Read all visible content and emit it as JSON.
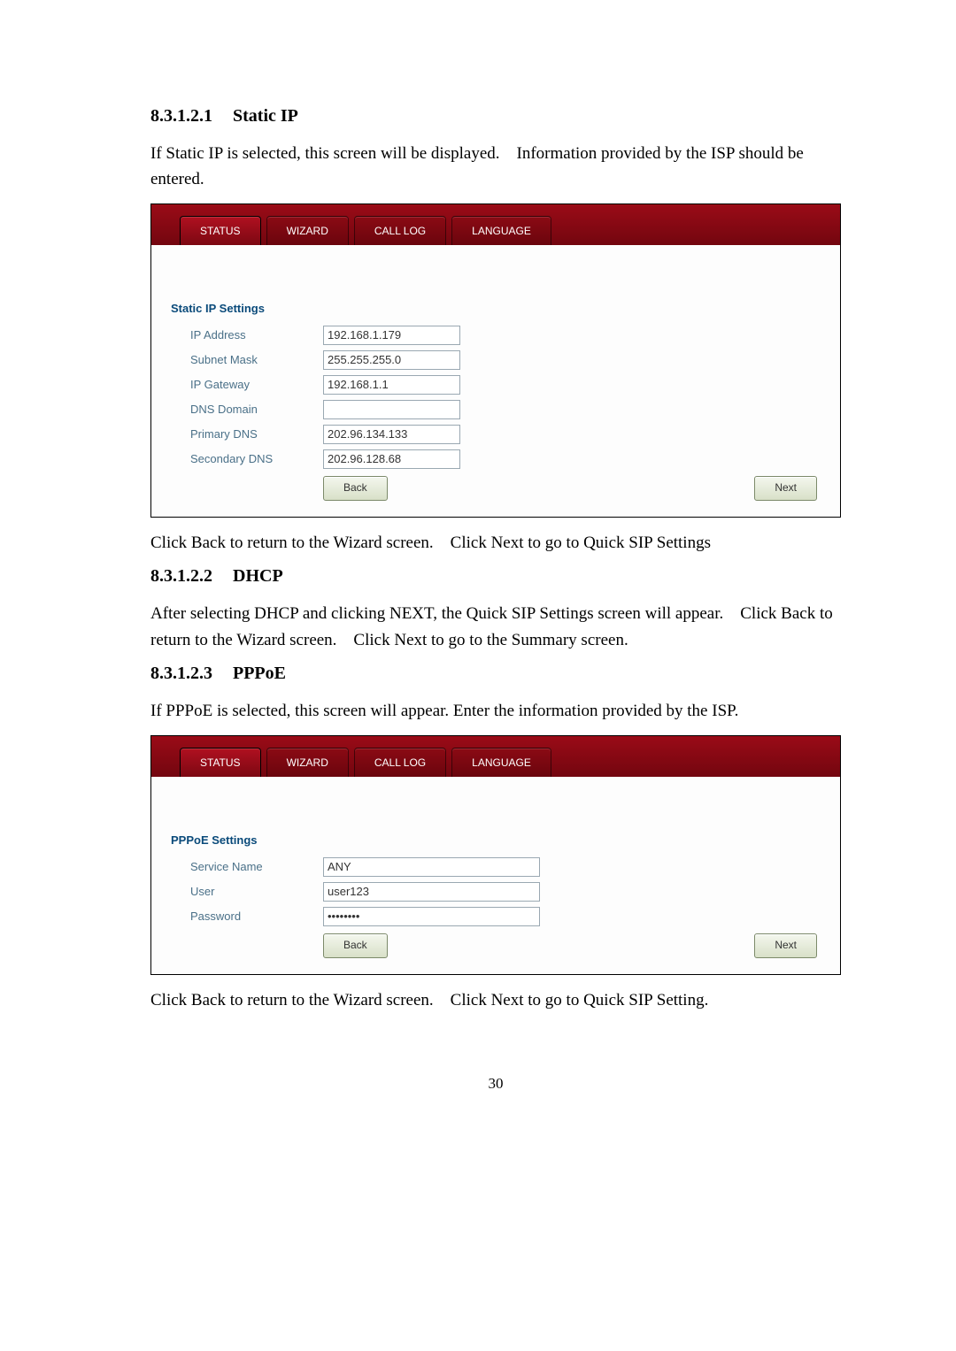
{
  "page_number": "30",
  "sections": {
    "s1": {
      "num": "8.3.1.2.1",
      "title": "Static IP",
      "para": "If Static IP is selected, this screen will be displayed. Information provided by the ISP should be entered.",
      "after": "Click Back to return to the Wizard screen. Click Next to go to Quick SIP Settings"
    },
    "s2": {
      "num": "8.3.1.2.2",
      "title": "DHCP",
      "para": "After selecting DHCP and clicking NEXT, the Quick SIP Settings screen will appear. Click Back to return to the Wizard screen. Click Next to go to the Summary screen."
    },
    "s3": {
      "num": "8.3.1.2.3",
      "title": "PPPoE",
      "para": "If PPPoE is selected, this screen will appear. Enter the information provided by the ISP.",
      "after": "Click Back to return to the Wizard screen. Click Next to go to Quick SIP Setting."
    }
  },
  "tabs": {
    "status": "STATUS",
    "wizard": "WIZARD",
    "call_log": "CALL LOG",
    "language": "LANGUAGE"
  },
  "static_ip": {
    "heading": "Static IP Settings",
    "labels": {
      "ip_address": "IP Address",
      "subnet_mask": "Subnet Mask",
      "ip_gateway": "IP Gateway",
      "dns_domain": "DNS Domain",
      "primary_dns": "Primary DNS",
      "secondary_dns": "Secondary DNS"
    },
    "values": {
      "ip_address": "192.168.1.179",
      "subnet_mask": "255.255.255.0",
      "ip_gateway": "192.168.1.1",
      "dns_domain": "",
      "primary_dns": "202.96.134.133",
      "secondary_dns": "202.96.128.68"
    },
    "buttons": {
      "back": "Back",
      "next": "Next"
    }
  },
  "pppoe": {
    "heading": "PPPoE Settings",
    "labels": {
      "service_name": "Service Name",
      "user": "User",
      "password": "Password"
    },
    "values": {
      "service_name": "ANY",
      "user": "user123",
      "password": "••••••••"
    },
    "buttons": {
      "back": "Back",
      "next": "Next"
    }
  }
}
